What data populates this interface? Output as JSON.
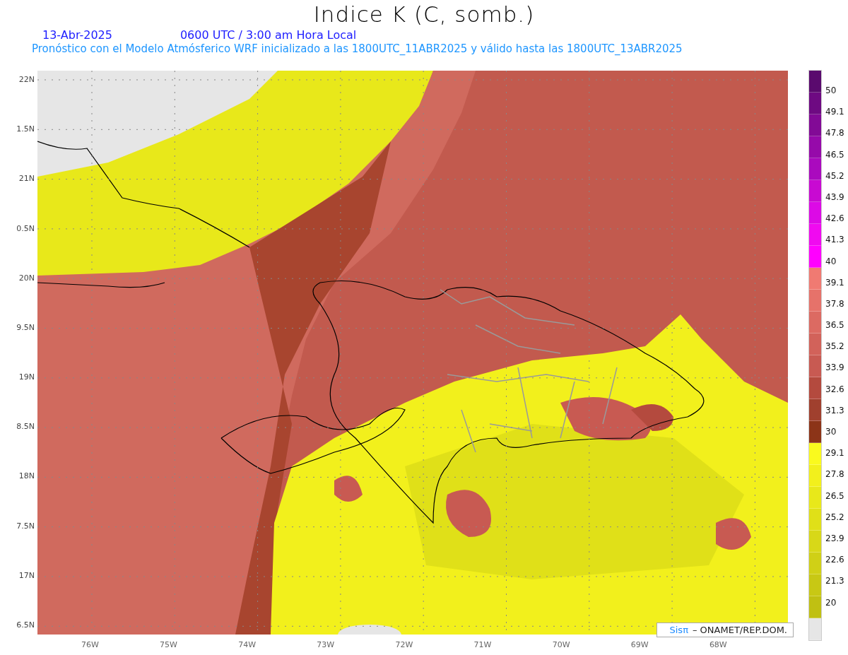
{
  "title": "Indice K (C, somb.)",
  "subtitle": {
    "date": "13-Abr-2025",
    "time": "0600 UTC / 3:00 am Hora Local"
  },
  "description": "Pronóstico con el Modelo Atmósferico WRF inicializado a las 1800UTC_11ABR2025 y válido hasta las  1800UTC_13ABR2025",
  "map": {
    "y_labels": [
      "22N",
      "1.5N",
      "21N",
      "0.5N",
      "20N",
      "9.5N",
      "19N",
      "8.5N",
      "18N",
      "7.5N",
      "17N",
      "6.5N"
    ],
    "x_labels": [
      "76W",
      "75W",
      "74W",
      "73W",
      "72W",
      "71W",
      "70W",
      "69W",
      "68W"
    ],
    "credit": {
      "brand": "Sisπ",
      "text": "– ONAMET/REP.DOM."
    }
  },
  "colorbar": {
    "swatches": [
      {
        "color": "#5a0a6e"
      },
      {
        "color": "#6e0a82"
      },
      {
        "color": "#820a96"
      },
      {
        "color": "#960aaa"
      },
      {
        "color": "#aa0abe"
      },
      {
        "color": "#c80ad2"
      },
      {
        "color": "#dc0ae6"
      },
      {
        "color": "#f00af0"
      },
      {
        "color": "#ff00ff"
      },
      {
        "color": "#f07a72"
      },
      {
        "color": "#e6726a"
      },
      {
        "color": "#dc6a62"
      },
      {
        "color": "#d2625a"
      },
      {
        "color": "#c85a52"
      },
      {
        "color": "#b44a3e"
      },
      {
        "color": "#a0402e"
      },
      {
        "color": "#8c3418"
      },
      {
        "color": "#fafa1e"
      },
      {
        "color": "#f2f01c"
      },
      {
        "color": "#e8e81a"
      },
      {
        "color": "#e0e018"
      },
      {
        "color": "#d8d818"
      },
      {
        "color": "#d0d016"
      },
      {
        "color": "#c8c814"
      },
      {
        "color": "#c0c012"
      },
      {
        "color": "#e6e6e6"
      }
    ],
    "labels": [
      "50",
      "49.1",
      "47.8",
      "46.5",
      "45.2",
      "43.9",
      "42.6",
      "41.3",
      "40",
      "39.1",
      "37.8",
      "36.5",
      "35.2",
      "33.9",
      "32.6",
      "31.3",
      "30",
      "29.1",
      "27.8",
      "26.5",
      "25.2",
      "23.9",
      "22.6",
      "21.3",
      "20"
    ]
  }
}
